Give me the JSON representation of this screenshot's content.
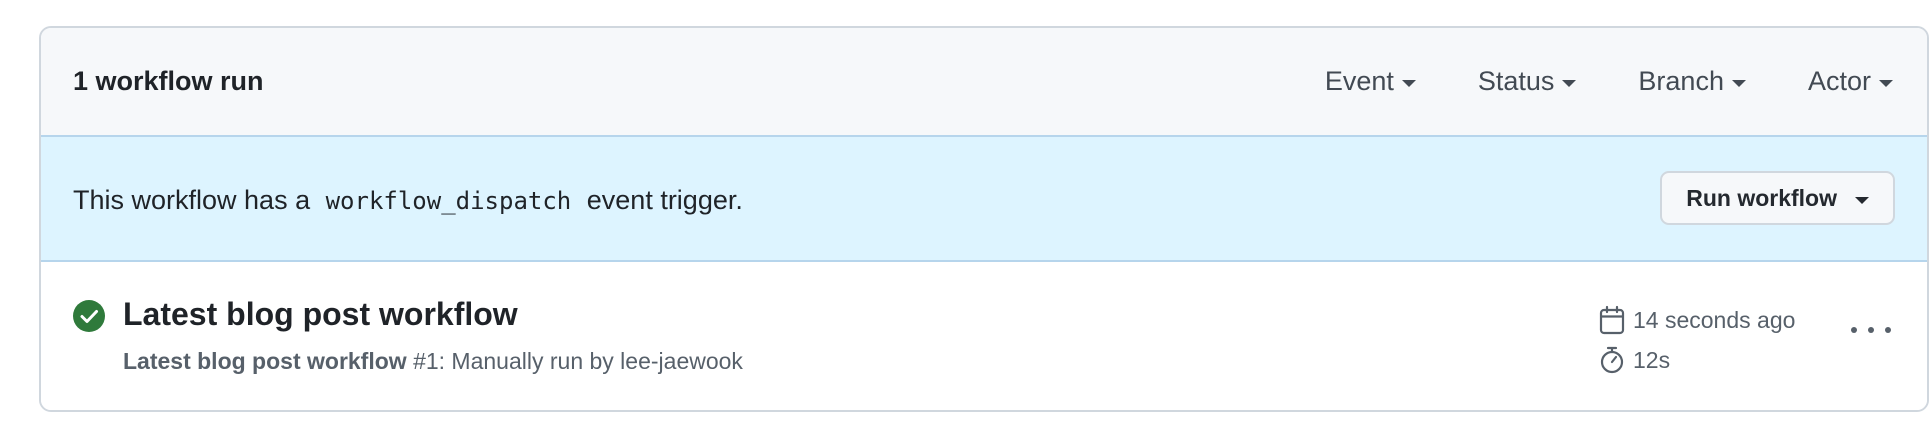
{
  "header": {
    "run_count": "1 workflow run",
    "filters": [
      {
        "label": "Event"
      },
      {
        "label": "Status"
      },
      {
        "label": "Branch"
      },
      {
        "label": "Actor"
      }
    ]
  },
  "dispatch": {
    "prefix": "This workflow has a",
    "code": "workflow_dispatch",
    "suffix": "event trigger.",
    "button_label": "Run workflow"
  },
  "run": {
    "status": "success",
    "status_icon": "check-circle-fill-icon",
    "title": "Latest blog post workflow",
    "workflow_name": "Latest blog post workflow",
    "run_number": "#1",
    "description": ": Manually run by lee-jaewook",
    "time_ago": "14 seconds ago",
    "duration": "12s",
    "time_icon": "calendar-icon",
    "duration_icon": "stopwatch-icon",
    "menu_icon": "kebab-horizontal-icon"
  },
  "colors": {
    "success": "#2f7a3b",
    "header_bg": "#f6f8fa",
    "dispatch_bg": "#ddf4ff",
    "border": "#d0d7de",
    "muted_text": "#57606a"
  }
}
